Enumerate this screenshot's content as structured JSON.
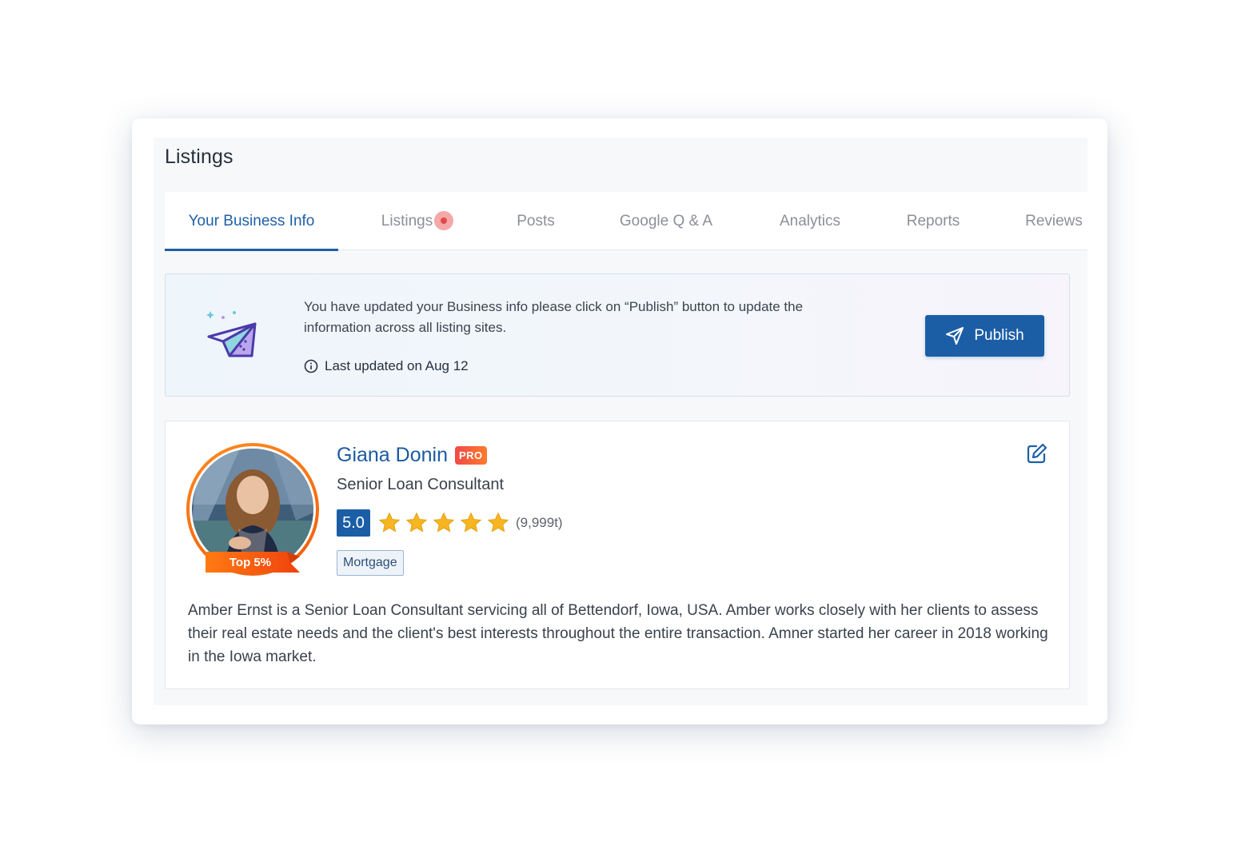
{
  "page": {
    "title": "Listings"
  },
  "tabs": [
    {
      "label": "Your Business Info",
      "active": true
    },
    {
      "label": "Listings",
      "has_notification": true
    },
    {
      "label": "Posts"
    },
    {
      "label": "Google Q & A"
    },
    {
      "label": "Analytics"
    },
    {
      "label": "Reports"
    },
    {
      "label": "Reviews"
    }
  ],
  "banner": {
    "message": "You have updated your Business info please click on “Publish” button to update the information across all listing sites.",
    "last_updated": "Last updated on Aug 12",
    "publish_label": "Publish",
    "icon": "paper-plane-icon"
  },
  "profile": {
    "name": "Giana Donin",
    "badge": "PRO",
    "title": "Senior Loan Consultant",
    "rating": "5.0",
    "stars": 5,
    "review_count": "(9,999t)",
    "rank_label": "Top 5%",
    "tag": "Mortgage",
    "bio": "Amber Ernst is a Senior Loan Consultant servicing all of Bettendorf, Iowa, USA. Amber works closely with her clients to assess their real estate needs and the client's best interests throughout the entire transaction. Amner started her career in 2018 working in the Iowa market."
  },
  "colors": {
    "primary": "#1b5ea6",
    "active_tab": "#1f5fa6",
    "star": "#f7b521",
    "pro_badge": "#f04a4a",
    "ring": "#f26b12"
  }
}
